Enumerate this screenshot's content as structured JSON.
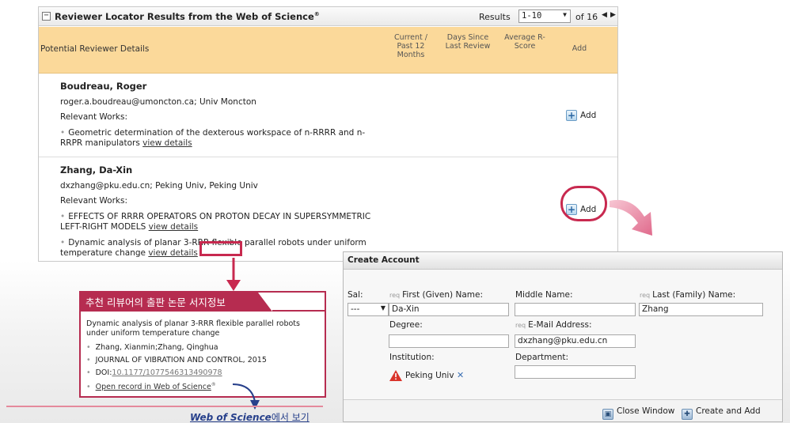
{
  "results_panel": {
    "title": "Reviewer Locator Results from the Web of Science",
    "title_sup": "®",
    "results_label": "Results",
    "results_range": "1-10",
    "results_total": "of 16",
    "columns": {
      "details": "Potential Reviewer Details",
      "current": "Current / Past 12 Months",
      "days": "Days Since Last Review",
      "avg": "Average R-Score",
      "add": "Add"
    },
    "reviewers": [
      {
        "name": "Boudreau, Roger",
        "email": "roger.a.boudreau@umoncton.ca; Univ Moncton",
        "works_label": "Relevant Works:",
        "works": [
          {
            "text": "Geometric determination of the dexterous workspace of n-RRRR and n-RRPR manipulators",
            "link": "view details"
          }
        ],
        "add_label": "Add"
      },
      {
        "name": "Zhang, Da-Xin",
        "email": "dxzhang@pku.edu.cn; Peking Univ, Peking Univ",
        "works_label": "Relevant Works:",
        "works": [
          {
            "text": "EFFECTS OF RRRR OPERATORS ON PROTON DECAY IN SUPERSYMMETRIC LEFT-RIGHT MODELS",
            "link": "view details"
          },
          {
            "text": "Dynamic analysis of planar 3-RRR flexible parallel robots under uniform temperature change",
            "link": "view details"
          }
        ],
        "add_label": "Add"
      }
    ]
  },
  "info_panel": {
    "title": "추천 리뷰어의 출판 논문 서지정보",
    "paper_title": "Dynamic analysis of planar 3-RRR flexible parallel robots under uniform temperature change",
    "authors": "Zhang, Xianmin;Zhang, Qinghua",
    "journal": "JOURNAL OF VIBRATION AND CONTROL, 2015",
    "doi_label": "DOI:",
    "doi_value": "10.1177/1077546313490978",
    "open_record": "Open record in Web of Science",
    "open_record_sup": "®"
  },
  "caption": {
    "wos": "Web of Science",
    "suffix": "에서 보기"
  },
  "create_account": {
    "title": "Create Account",
    "sal_label": "Sal:",
    "sal_value": "---",
    "req_marker": "req",
    "first_name_label": "First (Given) Name:",
    "first_name_value": "Da-Xin",
    "middle_name_label": "Middle Name:",
    "middle_name_value": "",
    "last_name_label": "Last (Family) Name:",
    "last_name_value": "Zhang",
    "degree_label": "Degree:",
    "degree_value": "",
    "email_label": "E-Mail Address:",
    "email_value": "dxzhang@pku.edu.cn",
    "institution_label": "Institution:",
    "institution_value": "Peking Univ",
    "department_label": "Department:",
    "department_value": "",
    "close_label": "Close Window",
    "create_label": "Create and Add"
  },
  "colors": {
    "accent": "#c8294f",
    "header_band": "#fbd99a",
    "link_blue": "#27408b"
  },
  "icons": [
    "collapse-icon",
    "prev-icon",
    "next-icon",
    "plus-icon",
    "warning-icon",
    "remove-icon",
    "close-window-icon",
    "create-add-icon"
  ]
}
